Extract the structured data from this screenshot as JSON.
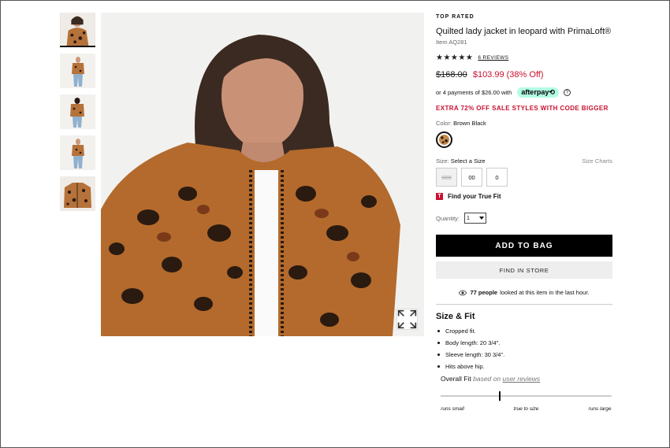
{
  "product": {
    "badge": "TOP RATED",
    "title": "Quilted lady jacket in leopard with PrimaLoft®",
    "item_number": "Item AQ281",
    "stars": "★★★★★",
    "reviews_link": "6 REVIEWS",
    "price_original": "$168.00",
    "price_sale": "$103.99 (38% Off)"
  },
  "afterpay": {
    "text": "or 4 payments of $26.00 with",
    "badge": "afterpay⟲",
    "info": "?"
  },
  "promo": "EXTRA 72% OFF SALE STYLES WITH CODE BIGGER",
  "color": {
    "label": "Color:",
    "value": "Brown Black"
  },
  "size": {
    "label": "Size:",
    "value": "Select a Size",
    "charts_link": "Size Charts",
    "options": [
      "000",
      "00",
      "0"
    ]
  },
  "truefit": {
    "icon": "T",
    "label": "Find your True Fit"
  },
  "quantity": {
    "label": "Quantity:",
    "value": "1"
  },
  "buttons": {
    "add_to_bag": "ADD TO BAG",
    "find_in_store": "FIND IN STORE"
  },
  "viewers": {
    "count": "77 people",
    "text": "looked at this item in the last hour."
  },
  "size_fit": {
    "title": "Size & Fit",
    "bullets": [
      "Cropped fit.",
      "Body length: 20 3/4\".",
      "Sleeve length: 30 3/4\".",
      "Hits above hip."
    ],
    "overall_label": "Overall Fit",
    "based_on": "based on",
    "user_reviews": "user reviews",
    "scale": [
      "runs small",
      "true to size",
      "runs large"
    ],
    "fit_position": 0.34
  },
  "colors": {
    "sale_red": "#c8102e",
    "afterpay_mint": "#b2fce4",
    "leopard_base": "#c58a4a"
  }
}
